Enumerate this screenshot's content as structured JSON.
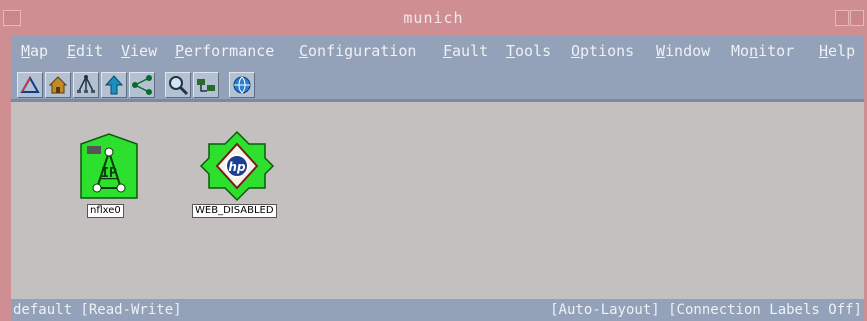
{
  "window": {
    "title": "munich"
  },
  "menu": [
    {
      "label": "Map",
      "mnemonic": "M",
      "rest": "ap"
    },
    {
      "label": "Edit",
      "mnemonic": "E",
      "rest": "dit"
    },
    {
      "label": "View",
      "mnemonic": "V",
      "rest": "iew"
    },
    {
      "label": "Performance",
      "mnemonic": "P",
      "rest": "erformance"
    },
    {
      "label": "Configuration",
      "mnemonic": "C",
      "rest": "onfiguration"
    },
    {
      "label": "Fault",
      "mnemonic": "F",
      "rest": "ault"
    },
    {
      "label": "Tools",
      "mnemonic": "T",
      "rest": "ools"
    },
    {
      "label": "Options",
      "mnemonic": "O",
      "rest": "ptions"
    },
    {
      "label": "Window",
      "mnemonic": "W",
      "rest": "indow"
    },
    {
      "label": "Monitor",
      "pre": "Mo",
      "mnemonic": "n",
      "rest": "itor"
    },
    {
      "label": "Help",
      "mnemonic": "H",
      "rest": "elp"
    }
  ],
  "toolbar": {
    "icons": [
      "measure-icon",
      "home-icon",
      "network-tree-icon",
      "up-arrow-icon",
      "connect-nodes-icon",
      "zoom-search-icon",
      "network-segment-icon",
      "globe-icon"
    ]
  },
  "nodes": [
    {
      "label": "nflxe0",
      "icon": "ip-network-icon",
      "color": "#2de02d"
    },
    {
      "label": "WEB_DISABLED",
      "icon": "hp-web-icon",
      "color": "#2de02d"
    }
  ],
  "status": {
    "left": "default [Read-Write]",
    "right": "[Auto-Layout] [Connection Labels Off]"
  },
  "colors": {
    "titlebar": "#cf8e92",
    "menubar": "#93a2b8",
    "canvas": "#c4c0c0",
    "node_green": "#2de02d"
  }
}
